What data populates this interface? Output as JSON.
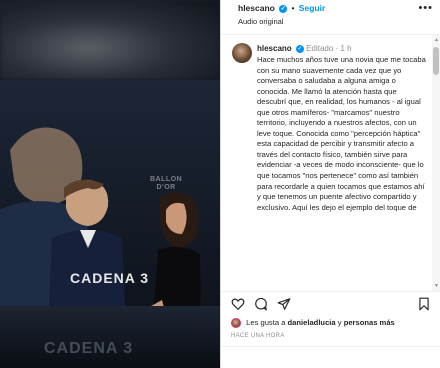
{
  "media": {
    "watermark_line1": "BALLON",
    "watermark_line2": "D'OR",
    "channel": "CADENA 3",
    "channel_ghost": "CADENA 3"
  },
  "header": {
    "username": "hlescano",
    "separator": "•",
    "follow_label": "Seguir",
    "audio": "Audio original",
    "more": "•••"
  },
  "post": {
    "username": "hlescano",
    "edited": "Editado",
    "time": "1 h",
    "caption": "Hace muchos años tuve una novia que me tocaba con su mano suavemente cada vez que yo conversaba o saludaba a alguna amiga o conocida. Me llamó la atención hasta que descubrí que, en realidad, los humanos - al igual que otros mamíferos- \"marcamos\" nuestro territorio, incluyendo a nuestros afectos, con un leve toque. Conocida como \"percepción háptica\" esta capacidad de percibir y transmitir afecto a través del contacto físico, también sirve para evidenciar -a veces de modo inconsciente- que lo que tocamos \"nos pertenece\" como así también para recordarle a quien tocamos que estamos ahí y que tenemos un puente afectivo compartido y exclusivo. Aquí les dejo el ejemplo del toque de"
  },
  "likes": {
    "prefix": "Les gusta a",
    "user": "danieladlucia",
    "connector": "y",
    "others": "personas más"
  },
  "timestamp": "HACE UNA HORA",
  "icons": {
    "like": "heart-icon",
    "comment": "comment-icon",
    "share": "share-icon",
    "save": "bookmark-icon"
  },
  "colors": {
    "accent": "#0095f6",
    "text": "#262626",
    "muted": "#8e8e8e"
  }
}
